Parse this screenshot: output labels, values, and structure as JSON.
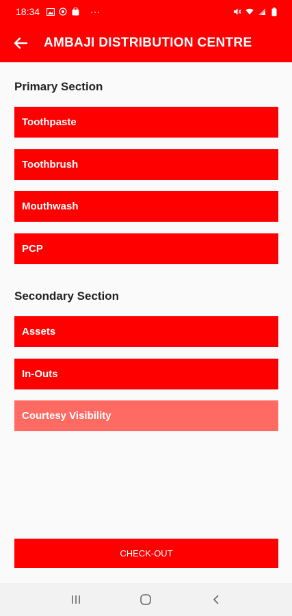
{
  "status_bar": {
    "time": "18:34",
    "more": "···"
  },
  "app_bar": {
    "title": "AMBAJI DISTRIBUTION CENTRE"
  },
  "primary_section": {
    "title": "Primary Section",
    "items": [
      "Toothpaste",
      "Toothbrush",
      "Mouthwash",
      "PCP"
    ]
  },
  "secondary_section": {
    "title": "Secondary Section",
    "items": [
      "Assets",
      "In-Outs",
      "Courtesy Visibility"
    ]
  },
  "checkout_label": "CHECK-OUT",
  "colors": {
    "primary": "#ff0000",
    "disabled": "#ff6a63",
    "background": "#fafafa"
  }
}
